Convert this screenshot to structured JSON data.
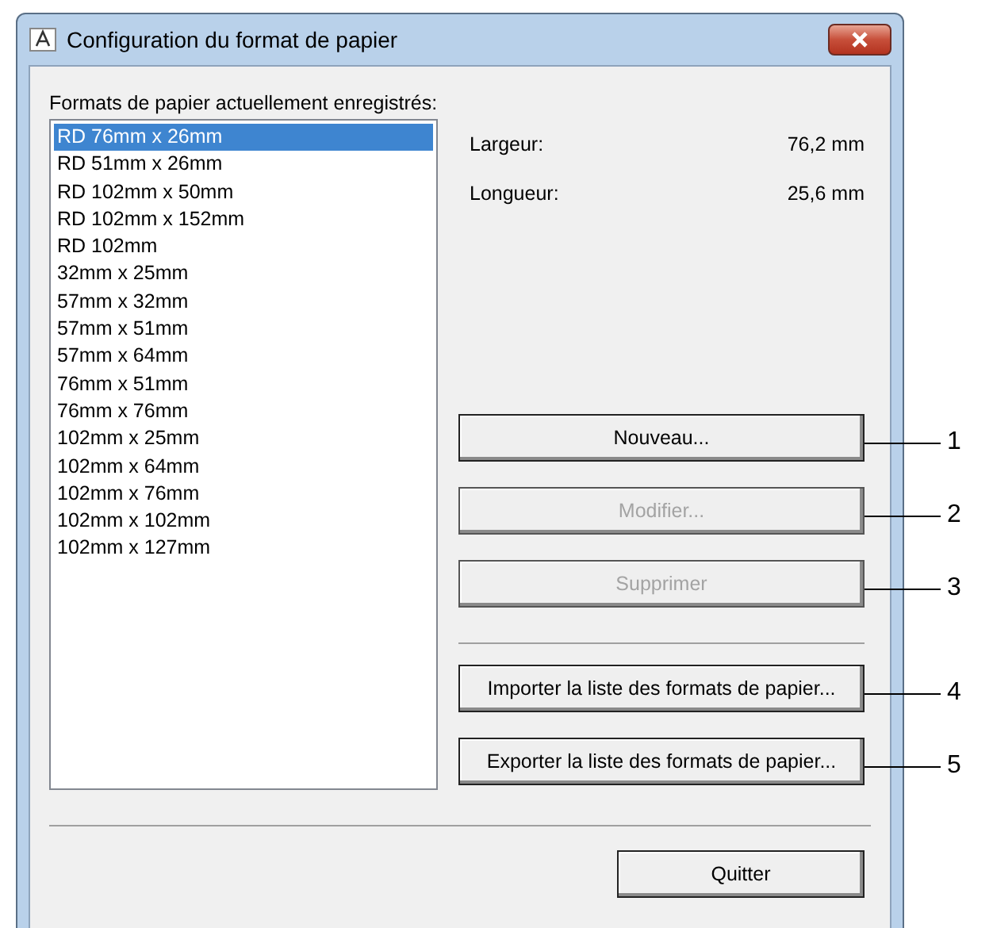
{
  "window": {
    "title": "Configuration du format de papier"
  },
  "list_label": "Formats de papier actuellement enregistrés:",
  "formats": [
    {
      "label": "RD 76mm x 26mm",
      "selected": true
    },
    {
      "label": "RD 51mm x 26mm",
      "selected": false
    },
    {
      "label": "RD 102mm x 50mm",
      "selected": false
    },
    {
      "label": "RD 102mm x 152mm",
      "selected": false
    },
    {
      "label": "RD 102mm",
      "selected": false
    },
    {
      "label": "32mm x 25mm",
      "selected": false
    },
    {
      "label": "57mm x 32mm",
      "selected": false
    },
    {
      "label": "57mm x 51mm",
      "selected": false
    },
    {
      "label": "57mm x 64mm",
      "selected": false
    },
    {
      "label": "76mm x 51mm",
      "selected": false
    },
    {
      "label": "76mm x 76mm",
      "selected": false
    },
    {
      "label": "102mm x 25mm",
      "selected": false
    },
    {
      "label": "102mm x 64mm",
      "selected": false
    },
    {
      "label": "102mm x 76mm",
      "selected": false
    },
    {
      "label": "102mm x 102mm",
      "selected": false
    },
    {
      "label": "102mm x 127mm",
      "selected": false
    }
  ],
  "details": [
    {
      "label": "Largeur:",
      "value": "76,2 mm"
    },
    {
      "label": "Longueur:",
      "value": "25,6 mm"
    }
  ],
  "button_groups": [
    [
      {
        "label": "Nouveau...",
        "disabled": false,
        "callout": "1"
      },
      {
        "label": "Modifier...",
        "disabled": true,
        "callout": "2"
      },
      {
        "label": "Supprimer",
        "disabled": true,
        "callout": "3"
      }
    ],
    [
      {
        "label": "Importer la liste des formats de papier...",
        "disabled": false,
        "callout": "4"
      },
      {
        "label": "Exporter la liste des formats de papier...",
        "disabled": false,
        "callout": "5"
      }
    ]
  ],
  "quit_button": "Quitter"
}
